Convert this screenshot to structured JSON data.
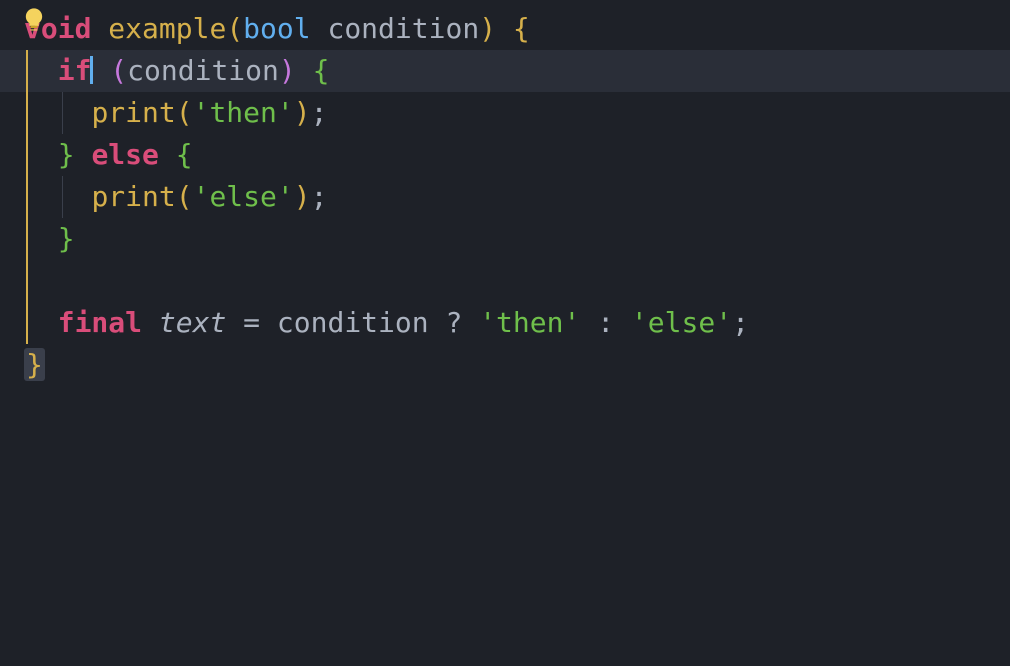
{
  "icons": {
    "bulb": "lightbulb-icon"
  },
  "code": {
    "l1": {
      "void": "void",
      "fn": "example",
      "bool": "bool",
      "param": "condition"
    },
    "l2": {
      "if": "if",
      "cond": "condition"
    },
    "l3": {
      "call": "print",
      "arg": "'then'"
    },
    "l4": {
      "else": "else"
    },
    "l5": {
      "call": "print",
      "arg": "'else'"
    },
    "l8": {
      "final": "final",
      "name": "text",
      "eq": "=",
      "cond": "condition",
      "q": "?",
      "then": "'then'",
      "colon": ":",
      "else": "'else'"
    }
  }
}
